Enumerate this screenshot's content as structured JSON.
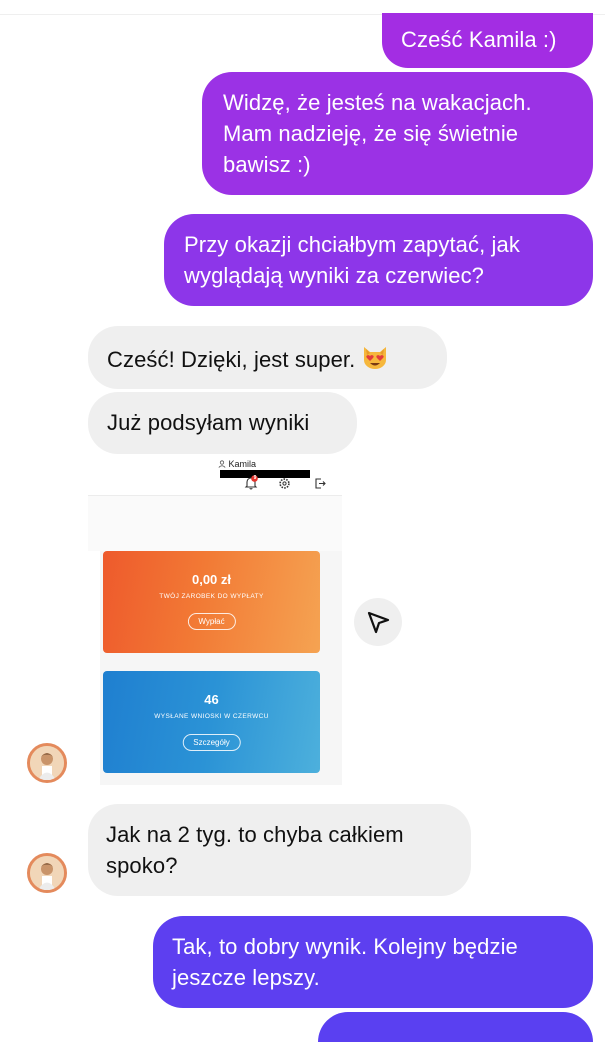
{
  "messages": {
    "m1": "Cześć Kamila :)",
    "m2": "Widzę, że jesteś na wakacjach.\nMam nadzieję, że się świetnie\nbawisz :)",
    "m3": "Przy okazji chciałbym zapytać, jak\nwyglądają wyniki za czerwiec?",
    "m4": "Cześć! Dzięki, jest super.",
    "m4_emoji": "smiling-cat-heart-eyes",
    "m5": "Już podsyłam wyniki",
    "m8": "Jak na 2 tyg. to chyba całkiem\nspoko?",
    "m6": "Tak, to dobry wynik. Kolejny będzie\njeszcze lepszy."
  },
  "shared_image": {
    "user_name": "Kamila",
    "notification_count": "9",
    "card1": {
      "value": "0,00 zł",
      "label": "TWÓJ ZAROBEK DO WYPŁATY",
      "button": "Wypłać"
    },
    "card2": {
      "value": "46",
      "label": "WYSŁANE WNIOSKI W CZERWCU",
      "button": "Szczegóły"
    }
  },
  "icons": [
    "user-icon",
    "bell-icon",
    "gear-icon",
    "logout-icon",
    "send-arrow-icon",
    "avatar-icon"
  ],
  "colors": {
    "outgoing_top": "#a32de3",
    "outgoing_bottom": "#5d3ff0",
    "incoming": "#efefef",
    "card_orange": "#f27a35",
    "card_blue": "#2b93d6"
  }
}
